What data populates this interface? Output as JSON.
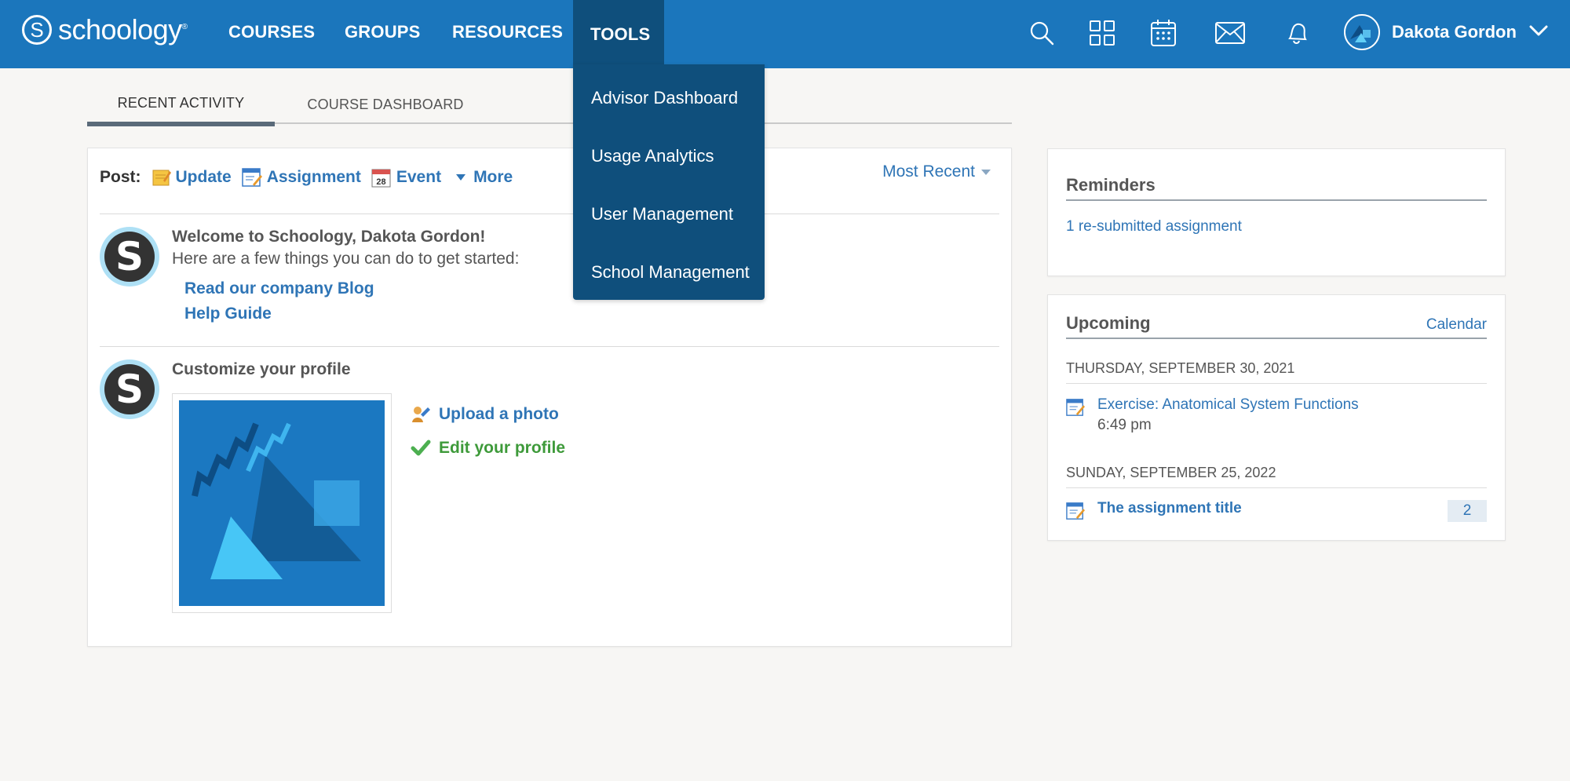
{
  "header": {
    "logo_text": "schoology",
    "logo_mark": "S",
    "nav": [
      "COURSES",
      "GROUPS",
      "RESOURCES",
      "TOOLS"
    ],
    "icons": [
      "search-icon",
      "apps-grid-icon",
      "calendar-icon",
      "mail-icon",
      "bell-icon"
    ],
    "user_name": "Dakota Gordon"
  },
  "tools_menu": {
    "items": [
      "Advisor Dashboard",
      "Usage Analytics",
      "User Management",
      "School Management"
    ]
  },
  "tabs": [
    "RECENT ACTIVITY",
    "COURSE DASHBOARD"
  ],
  "post_bar": {
    "label": "Post:",
    "update": "Update",
    "assignment": "Assignment",
    "event": "Event",
    "event_day": "28",
    "more": "More",
    "sort": "Most Recent"
  },
  "feed": {
    "welcome_title": "Welcome to Schoology, Dakota Gordon!",
    "welcome_sub": "Here are a few things you can do to get started:",
    "link_blog": "Read our company Blog",
    "link_help": "Help Guide",
    "avatar_letter": "S",
    "profile_title": "Customize your profile",
    "upload_photo": "Upload a photo",
    "edit_profile": "Edit your profile"
  },
  "reminders": {
    "title": "Reminders",
    "item": "1 re-submitted assignment"
  },
  "upcoming": {
    "title": "Upcoming",
    "calendar_link": "Calendar",
    "groups": [
      {
        "date": "THURSDAY, SEPTEMBER 30, 2021",
        "item": "Exercise: Anatomical System Functions",
        "time": "6:49 pm"
      },
      {
        "date": "SUNDAY, SEPTEMBER 25, 2022",
        "item": "The assignment title",
        "count": "2"
      }
    ]
  },
  "colors": {
    "header": "#1b76bc",
    "menu": "#0f4f7c",
    "link": "#2f75b6",
    "green": "#3e9a3a"
  }
}
